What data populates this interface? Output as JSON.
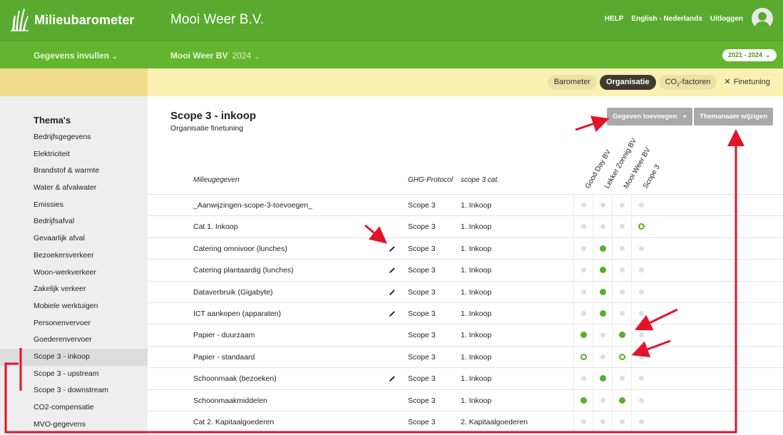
{
  "header": {
    "brand": "Milieubarometer",
    "company": "Mooi Weer B.V.",
    "links": [
      "HELP",
      "English - Nederlands",
      "Uitloggen"
    ]
  },
  "subbar": {
    "menu": "Gegevens invullen",
    "org": "Mooi Weer BV",
    "year": "2024",
    "range": "2021 - 2024"
  },
  "tabs": {
    "barometer": "Barometer",
    "organisatie": "Organisatie",
    "co2": "CO",
    "co2_sub": "2",
    "co2_tail": "-factoren",
    "finetuning": "Finetuning"
  },
  "sidebar": {
    "title": "Thema's",
    "items": [
      "Bedrijfsgegevens",
      "Elektriciteit",
      "Brandstof & warmte",
      "Water & afvalwater",
      "Emissies",
      "Bedrijfsafval",
      "Gevaarlijk afval",
      "Bezoekersverkeer",
      "Woon-werkverkeer",
      "Zakelijk verkeer",
      "Mobiele werktuigen",
      "Personenvervoer",
      "Goederenvervoer",
      "Scope 3 - inkoop",
      "Scope 3 - upstream",
      "Scope 3 - downstream",
      "CO2-compensatie",
      "MVO-gegevens"
    ],
    "active_index": 13
  },
  "main": {
    "title": "Scope 3 - inkoop",
    "subtitle": "Organisatie finetuning",
    "add_button": "Gegeven toevoegen",
    "add_plus": "+",
    "rename_button": "Themanaam wijzigen",
    "columns": {
      "name": "Milieugegeven",
      "ghg": "GHG-Protocol",
      "cat": "scope 3 cat.",
      "orgs": [
        "Good Day BV",
        "Lekker Zonnig BV",
        "Mooi Weer BV",
        "Scope 3"
      ]
    },
    "rows": [
      {
        "name": "_Aanwijzingen-scope-3-toevoegen_",
        "edit": false,
        "ghg": "Scope 3",
        "cat": "1. Inkoop",
        "dots": [
          "off",
          "off",
          "off",
          "off"
        ]
      },
      {
        "name": "Cat 1. Inkoop",
        "edit": false,
        "ghg": "Scope 3",
        "cat": "1. Inkoop",
        "dots": [
          "off",
          "off",
          "off",
          "ring"
        ]
      },
      {
        "name": "Catering omnivoor (lunches)",
        "edit": true,
        "ghg": "Scope 3",
        "cat": "1. Inkoop",
        "dots": [
          "off",
          "full",
          "off",
          "off"
        ]
      },
      {
        "name": "Catering plantaardig (lunches)",
        "edit": true,
        "ghg": "Scope 3",
        "cat": "1. Inkoop",
        "dots": [
          "off",
          "full",
          "off",
          "off"
        ]
      },
      {
        "name": "Dataverbruik (Gigabyte)",
        "edit": true,
        "ghg": "Scope 3",
        "cat": "1. Inkoop",
        "dots": [
          "off",
          "full",
          "off",
          "off"
        ]
      },
      {
        "name": "ICT aankopen (apparaten)",
        "edit": true,
        "ghg": "Scope 3",
        "cat": "1. Inkoop",
        "dots": [
          "off",
          "full",
          "off",
          "off"
        ]
      },
      {
        "name": "Papier - duurzaam",
        "edit": false,
        "ghg": "Scope 3",
        "cat": "1. Inkoop",
        "dots": [
          "full",
          "off",
          "full",
          "off"
        ]
      },
      {
        "name": "Papier - standaard",
        "edit": false,
        "ghg": "Scope 3",
        "cat": "1. Inkoop",
        "dots": [
          "ring",
          "off",
          "ring",
          "off"
        ]
      },
      {
        "name": "Schoonmaak (bezoeken)",
        "edit": true,
        "ghg": "Scope 3",
        "cat": "1. Inkoop",
        "dots": [
          "off",
          "full",
          "off",
          "off"
        ]
      },
      {
        "name": "Schoonmaakmiddelen",
        "edit": false,
        "ghg": "Scope 3",
        "cat": "1. Inkoop",
        "dots": [
          "full",
          "off",
          "full",
          "off"
        ]
      },
      {
        "name": "Cat 2. Kapitaalgoederen",
        "edit": false,
        "ghg": "Scope 3",
        "cat": "2. Kapitaalgoederen",
        "dots": [
          "off",
          "off",
          "off",
          "off"
        ]
      }
    ]
  },
  "annotation_color": "#e3132b",
  "brand_green": "#5aaa2f"
}
